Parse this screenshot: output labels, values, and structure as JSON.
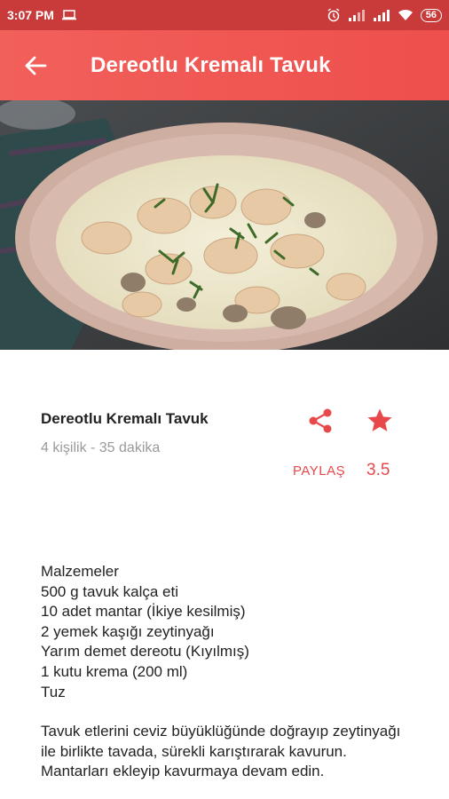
{
  "status_bar": {
    "time": "3:07 PM",
    "battery": "56"
  },
  "app_bar": {
    "title": "Dereotlu Kremalı Tavuk"
  },
  "recipe": {
    "title": "Dereotlu Kremalı Tavuk",
    "meta": "4 kişilik - 35 dakika",
    "share_label": "PAYLAŞ",
    "rating": "3.5"
  },
  "ingredients": {
    "heading": "Malzemeler",
    "items": [
      "500 g tavuk kalça eti",
      "10 adet mantar (İkiye kesilmiş)",
      "2 yemek kaşığı zeytinyağı",
      "Yarım demet dereotu (Kıyılmış)",
      "1 kutu krema (200 ml)",
      "Tuz"
    ]
  },
  "instructions": {
    "step1": "Tavuk etlerini ceviz büyüklüğünde doğrayıp zeytinyağı ile birlikte tavada, sürekli karıştırarak kavurun. Mantarları ekleyip kavurmaya devam edin."
  },
  "colors": {
    "status_bar": "#c93a3a",
    "app_bar": "#ef5350",
    "accent": "#e8484a"
  },
  "icons": [
    "back-arrow-icon",
    "share-icon",
    "star-icon",
    "alarm-icon",
    "signal-icon",
    "wifi-icon",
    "laptop-icon"
  ]
}
